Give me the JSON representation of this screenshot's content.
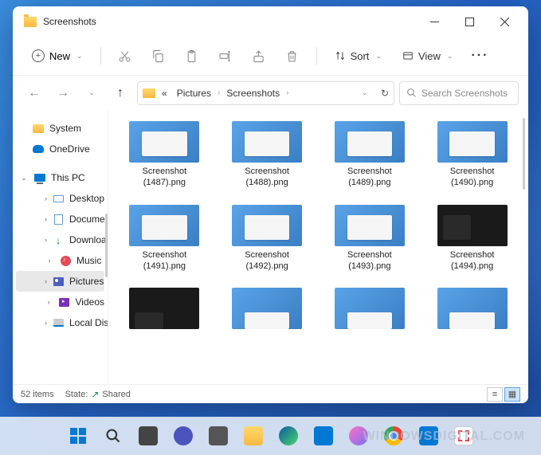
{
  "window": {
    "title": "Screenshots"
  },
  "toolbar": {
    "new_label": "New",
    "sort_label": "Sort",
    "view_label": "View"
  },
  "breadcrumb": {
    "sep_first": "«",
    "items": [
      "Pictures",
      "Screenshots"
    ]
  },
  "search": {
    "placeholder": "Search Screenshots"
  },
  "sidebar": {
    "items": [
      {
        "label": "System",
        "icon": "folder"
      },
      {
        "label": "OneDrive",
        "icon": "onedrive"
      },
      {
        "label": "This PC",
        "icon": "pc",
        "expanded": true
      },
      {
        "label": "Desktop",
        "icon": "desktop",
        "child": true
      },
      {
        "label": "Documents",
        "icon": "doc",
        "child": true
      },
      {
        "label": "Downloads",
        "icon": "down",
        "child": true
      },
      {
        "label": "Music",
        "icon": "music",
        "child": true
      },
      {
        "label": "Pictures",
        "icon": "pic",
        "child": true,
        "selected": true
      },
      {
        "label": "Videos",
        "icon": "vid",
        "child": true
      },
      {
        "label": "Local Disk",
        "icon": "disk",
        "child": true
      }
    ]
  },
  "files": [
    {
      "name": "Screenshot (1487).png",
      "thumb": "light"
    },
    {
      "name": "Screenshot (1488).png",
      "thumb": "light"
    },
    {
      "name": "Screenshot (1489).png",
      "thumb": "light"
    },
    {
      "name": "Screenshot (1490).png",
      "thumb": "light"
    },
    {
      "name": "Screenshot (1491).png",
      "thumb": "light"
    },
    {
      "name": "Screenshot (1492).png",
      "thumb": "light"
    },
    {
      "name": "Screenshot (1493).png",
      "thumb": "light"
    },
    {
      "name": "Screenshot (1494).png",
      "thumb": "dark"
    },
    {
      "name": "",
      "thumb": "dark-partial"
    },
    {
      "name": "",
      "thumb": "light-partial"
    },
    {
      "name": "",
      "thumb": "light-partial"
    },
    {
      "name": "",
      "thumb": "light-partial"
    }
  ],
  "status": {
    "item_count": "52 items",
    "state_label": "State:",
    "shared_label": "Shared"
  },
  "watermark": "WINDOWSDIGITAL.COM"
}
